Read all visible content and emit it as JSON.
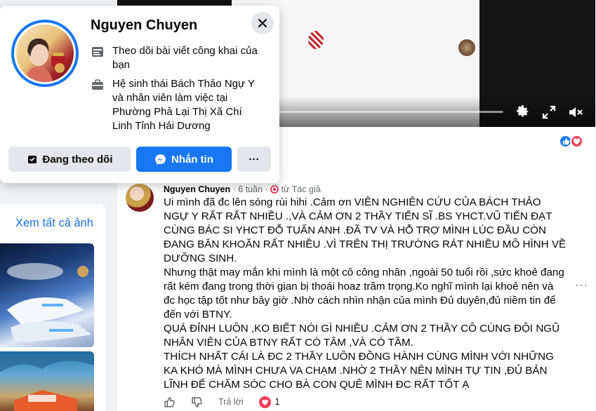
{
  "popup": {
    "name": "Nguyen Chuyen",
    "follow_info": "Theo dõi bài viết công khai của bạn",
    "work_info": "Hệ sinh thái Bách Thảo Ngự Y và nhân viên làm việc tại Phường Phả Lại Thị Xã Chí Linh Tỉnh Hải Dương",
    "following_label": "Đang theo dõi",
    "message_label": "Nhắn tin",
    "more_label": "···"
  },
  "sidebar": {
    "see_all_photos": "Xem tất cả ảnh"
  },
  "comment": {
    "author": "Nguyen Chuyen",
    "time": "6 tuần",
    "badge": "từ Tác giả",
    "text": "Ui mình đã đc lên sóng rùi hihi .Cảm ơn VIÊN NGHIÊN CỨU CỦA BÁCH THẢO NGỰ Y RẤT RẤT NHIỀU .,VÀ CẢM ƠN 2 THẦY TIẾN SĨ .BS YHCT.VŨ TIẾN ĐẠT\nCÙNG BÁC SI YHCT ĐỖ TUẤN ANH .ĐÃ TV VÀ HỖ TRỢ MÌNH LÚC ĐẦU CÒN ĐANG BĂN KHOĂN RẤT NHIỀU .VÌ TRÊN THỊ TRƯỜNG RÁT NHIỀU MÔ HÌNH VỀ DƯỠNG SINH.\nNhưng thật may mắn khi mình là một cô công nhân ,ngoài 50 tuổi rồi ,sức khoẻ đang rất kém đang trong thời gian bị thoái hoaz trầm trọng.Ko nghĩ mình lại khoẻ nên và đc học tập tốt như bây giờ .Nhờ cách nhìn nhận của mình Đủ duyên,đủ niềm tin để đến với BTNY.\nQUÁ ĐỈNH LUÔN ,KO BIẾT NÓI GÌ NHIỀU .CẢM ƠN 2 THẦY CÔ CÙNG ĐỘI NGŨ NHÂN VIÊN CỦA BTNY RẤT CÓ TÂM ,VÀ CÓ TẦM.\nTHÍCH NHẤT CÁI LÀ ĐC 2 THẦY LUÔN ĐỒNG HÀNH CÙNG MÌNH VỚI NHỮNG KA KHÓ MÀ MÌNH CHƯA VA CHẠM .NHỜ 2 THẦY NÊN MÌNH TỰ TIN ,ĐỦ BẢN LĨNH ĐỂ CHĂM SÓC CHO BÀ CON QUÊ MÌNH ĐC RẤT TỐT Ạ",
    "reply_label": "Trả lời",
    "reaction_count": "1",
    "more_label": "···"
  },
  "colors": {
    "accent": "#1877f2",
    "love": "#f33e58",
    "link": "#1b74e4",
    "secondary_text": "#65676b"
  },
  "icons": [
    "close-icon",
    "rss-feed-icon",
    "briefcase-icon",
    "following-icon",
    "messenger-icon",
    "more-icon",
    "settings-gear-icon",
    "fullscreen-icon",
    "mute-icon",
    "like-icon",
    "dislike-icon",
    "heart-icon"
  ]
}
